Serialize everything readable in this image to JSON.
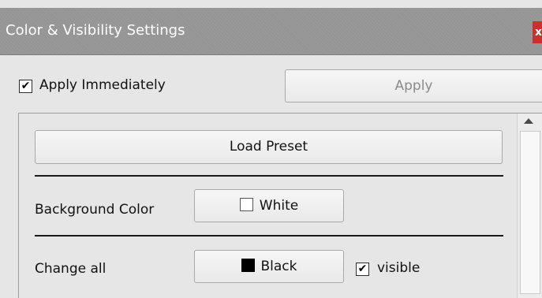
{
  "window": {
    "title": "Color & Visibility Settings",
    "close_label": "x"
  },
  "toolbar": {
    "apply_immediately_label": "Apply Immediately",
    "apply_immediately_checked": true,
    "apply_label": "Apply"
  },
  "panel": {
    "load_preset_label": "Load Preset",
    "background_color": {
      "label": "Background Color",
      "value": "White",
      "swatch_color": "#ffffff"
    },
    "change_all": {
      "label": "Change all",
      "value": "Black",
      "swatch_color": "#000000",
      "visible_label": "visible",
      "visible_checked": true
    }
  },
  "check_glyph": "✔"
}
